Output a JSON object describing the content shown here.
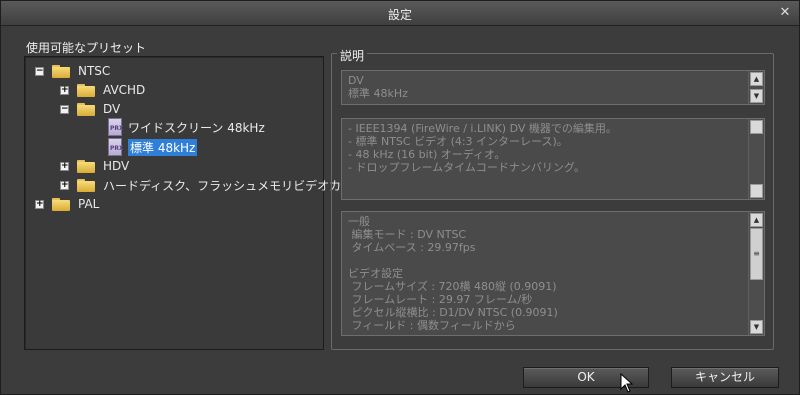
{
  "window": {
    "title": "設定",
    "close_glyph": "✕"
  },
  "presets": {
    "label": "使用可能なプリセット",
    "tree": [
      {
        "label": "NTSC",
        "type": "folder",
        "expander": "−"
      },
      {
        "label": "AVCHD",
        "type": "folder",
        "expander": "+"
      },
      {
        "label": "DV",
        "type": "folder",
        "expander": "−"
      },
      {
        "label": "ワイドスクリーン 48kHz",
        "type": "file",
        "icon_text": "PRX"
      },
      {
        "label": "標準 48kHz",
        "type": "file",
        "icon_text": "PRX",
        "selected": true
      },
      {
        "label": "HDV",
        "type": "folder",
        "expander": "+"
      },
      {
        "label": "ハードディスク、フラッシュメモリビデオカメラ",
        "type": "folder",
        "expander": "+"
      },
      {
        "label": "PAL",
        "type": "folder",
        "expander": "+"
      }
    ]
  },
  "description": {
    "label": "説明",
    "name_box": "DV\n標準 48kHz",
    "notes_box": "- IEEE1394 (FireWire / i.LINK) DV 機器での編集用。\n- 標準 NTSC ビデオ (4:3 インターレース)。\n- 48 kHz (16 bit) オーディオ。\n- ドロップフレームタイムコードナンバリング。",
    "details_box": "一般\n 編集モード : DV NTSC\n タイムベース : 29.97fps\n\nビデオ設定\n フレームサイズ : 720横 480縦 (0.9091)\n フレームレート : 29.97 フレーム/秒\n ピクセル縦横比 : D1/DV NTSC (0.9091)\n フィールド : 偶数フィールドから",
    "scroll_up": "▲",
    "scroll_down": "▼",
    "thumb_grip": "≡"
  },
  "buttons": {
    "ok": "OK",
    "cancel": "キャンセル"
  },
  "colors": {
    "selection": "#2f7ed8",
    "folder": "#e7c25a",
    "background": "#3c3c3c"
  }
}
